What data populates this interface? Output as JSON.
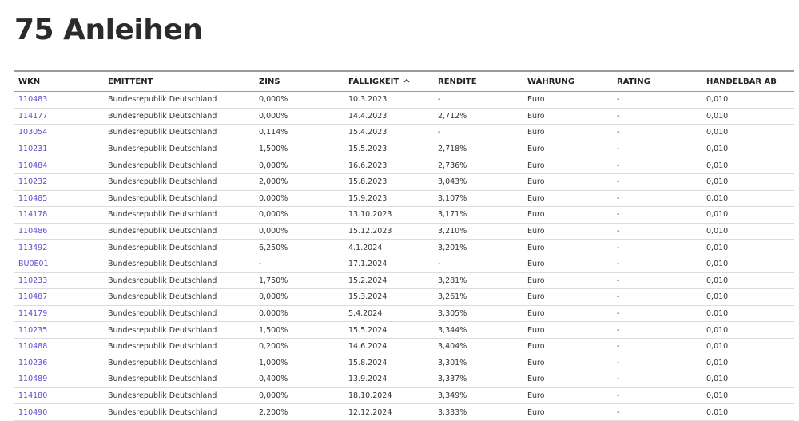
{
  "title": "75 Anleihen",
  "table": {
    "headers": {
      "wkn": "WKN",
      "issuer": "EMITTENT",
      "coupon": "ZINS",
      "maturity": "FÄLLIGKEIT",
      "yield": "RENDITE",
      "currency": "WÄHRUNG",
      "rating": "RATING",
      "tradable_from": "HANDELBAR AB"
    },
    "sort_indicator": "^",
    "rows": [
      {
        "wkn": "110483",
        "issuer": "Bundesrepublik Deutschland",
        "coupon": "0,000%",
        "maturity": "10.3.2023",
        "yield": "-",
        "currency": "Euro",
        "rating": "-",
        "tradable_from": "0,010"
      },
      {
        "wkn": "114177",
        "issuer": "Bundesrepublik Deutschland",
        "coupon": "0,000%",
        "maturity": "14.4.2023",
        "yield": "2,712%",
        "currency": "Euro",
        "rating": "-",
        "tradable_from": "0,010"
      },
      {
        "wkn": "103054",
        "issuer": "Bundesrepublik Deutschland",
        "coupon": "0,114%",
        "maturity": "15.4.2023",
        "yield": "-",
        "currency": "Euro",
        "rating": "-",
        "tradable_from": "0,010"
      },
      {
        "wkn": "110231",
        "issuer": "Bundesrepublik Deutschland",
        "coupon": "1,500%",
        "maturity": "15.5.2023",
        "yield": "2,718%",
        "currency": "Euro",
        "rating": "-",
        "tradable_from": "0,010"
      },
      {
        "wkn": "110484",
        "issuer": "Bundesrepublik Deutschland",
        "coupon": "0,000%",
        "maturity": "16.6.2023",
        "yield": "2,736%",
        "currency": "Euro",
        "rating": "-",
        "tradable_from": "0,010"
      },
      {
        "wkn": "110232",
        "issuer": "Bundesrepublik Deutschland",
        "coupon": "2,000%",
        "maturity": "15.8.2023",
        "yield": "3,043%",
        "currency": "Euro",
        "rating": "-",
        "tradable_from": "0,010"
      },
      {
        "wkn": "110485",
        "issuer": "Bundesrepublik Deutschland",
        "coupon": "0,000%",
        "maturity": "15.9.2023",
        "yield": "3,107%",
        "currency": "Euro",
        "rating": "-",
        "tradable_from": "0,010"
      },
      {
        "wkn": "114178",
        "issuer": "Bundesrepublik Deutschland",
        "coupon": "0,000%",
        "maturity": "13.10.2023",
        "yield": "3,171%",
        "currency": "Euro",
        "rating": "-",
        "tradable_from": "0,010"
      },
      {
        "wkn": "110486",
        "issuer": "Bundesrepublik Deutschland",
        "coupon": "0,000%",
        "maturity": "15.12.2023",
        "yield": "3,210%",
        "currency": "Euro",
        "rating": "-",
        "tradable_from": "0,010"
      },
      {
        "wkn": "113492",
        "issuer": "Bundesrepublik Deutschland",
        "coupon": "6,250%",
        "maturity": "4.1.2024",
        "yield": "3,201%",
        "currency": "Euro",
        "rating": "-",
        "tradable_from": "0,010"
      },
      {
        "wkn": "BU0E01",
        "issuer": "Bundesrepublik Deutschland",
        "coupon": "-",
        "maturity": "17.1.2024",
        "yield": "-",
        "currency": "Euro",
        "rating": "-",
        "tradable_from": "0,010"
      },
      {
        "wkn": "110233",
        "issuer": "Bundesrepublik Deutschland",
        "coupon": "1,750%",
        "maturity": "15.2.2024",
        "yield": "3,281%",
        "currency": "Euro",
        "rating": "-",
        "tradable_from": "0,010"
      },
      {
        "wkn": "110487",
        "issuer": "Bundesrepublik Deutschland",
        "coupon": "0,000%",
        "maturity": "15.3.2024",
        "yield": "3,261%",
        "currency": "Euro",
        "rating": "-",
        "tradable_from": "0,010"
      },
      {
        "wkn": "114179",
        "issuer": "Bundesrepublik Deutschland",
        "coupon": "0,000%",
        "maturity": "5.4.2024",
        "yield": "3,305%",
        "currency": "Euro",
        "rating": "-",
        "tradable_from": "0,010"
      },
      {
        "wkn": "110235",
        "issuer": "Bundesrepublik Deutschland",
        "coupon": "1,500%",
        "maturity": "15.5.2024",
        "yield": "3,344%",
        "currency": "Euro",
        "rating": "-",
        "tradable_from": "0,010"
      },
      {
        "wkn": "110488",
        "issuer": "Bundesrepublik Deutschland",
        "coupon": "0,200%",
        "maturity": "14.6.2024",
        "yield": "3,404%",
        "currency": "Euro",
        "rating": "-",
        "tradable_from": "0,010"
      },
      {
        "wkn": "110236",
        "issuer": "Bundesrepublik Deutschland",
        "coupon": "1,000%",
        "maturity": "15.8.2024",
        "yield": "3,301%",
        "currency": "Euro",
        "rating": "-",
        "tradable_from": "0,010"
      },
      {
        "wkn": "110489",
        "issuer": "Bundesrepublik Deutschland",
        "coupon": "0,400%",
        "maturity": "13.9.2024",
        "yield": "3,337%",
        "currency": "Euro",
        "rating": "-",
        "tradable_from": "0,010"
      },
      {
        "wkn": "114180",
        "issuer": "Bundesrepublik Deutschland",
        "coupon": "0,000%",
        "maturity": "18.10.2024",
        "yield": "3,349%",
        "currency": "Euro",
        "rating": "-",
        "tradable_from": "0,010"
      },
      {
        "wkn": "110490",
        "issuer": "Bundesrepublik Deutschland",
        "coupon": "2,200%",
        "maturity": "12.12.2024",
        "yield": "3,333%",
        "currency": "Euro",
        "rating": "-",
        "tradable_from": "0,010"
      }
    ]
  },
  "colors": {
    "link": "#5a4fcf",
    "text": "#333333",
    "header_rule": "#9a9a9a",
    "row_rule": "#dcdcdc"
  }
}
